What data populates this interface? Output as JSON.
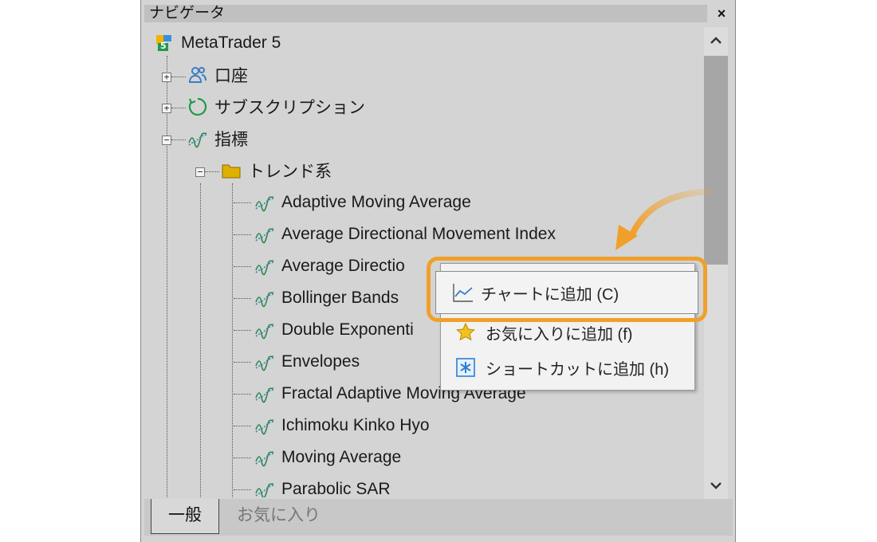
{
  "window": {
    "title": "ナビゲータ",
    "close": "×"
  },
  "tree": {
    "root": "MetaTrader 5",
    "account": "口座",
    "subscription": "サブスクリプション",
    "indicators": "指標",
    "trend_folder": "トレンド系",
    "items": [
      "Adaptive Moving Average",
      "Average Directional Movement Index",
      "Average Directio",
      "Bollinger Bands",
      "Double Exponenti",
      "Envelopes",
      "Fractal Adaptive Moving Average",
      "Ichimoku Kinko Hyo",
      "Moving Average",
      "Parabolic SAR"
    ]
  },
  "context_menu": {
    "add_to_chart": "チャートに追加 (C)",
    "add_to_favorites": "お気に入りに追加 (f)",
    "add_shortcut": "ショートカットに追加 (h)"
  },
  "tabs": {
    "general": "一般",
    "favorites": "お気に入り"
  },
  "colors": {
    "highlight": "#f0a02a",
    "indicator": "#2a8a4a",
    "folder": "#e0b000",
    "account": "#3a7fc4"
  },
  "icons": {
    "root": "metatrader-logo-icon",
    "account": "users-icon",
    "subscription": "refresh-icon",
    "indicator": "indicator-wave-icon",
    "folder": "folder-icon",
    "chart": "line-chart-icon",
    "star": "star-icon",
    "shortcut": "asterisk-icon"
  }
}
